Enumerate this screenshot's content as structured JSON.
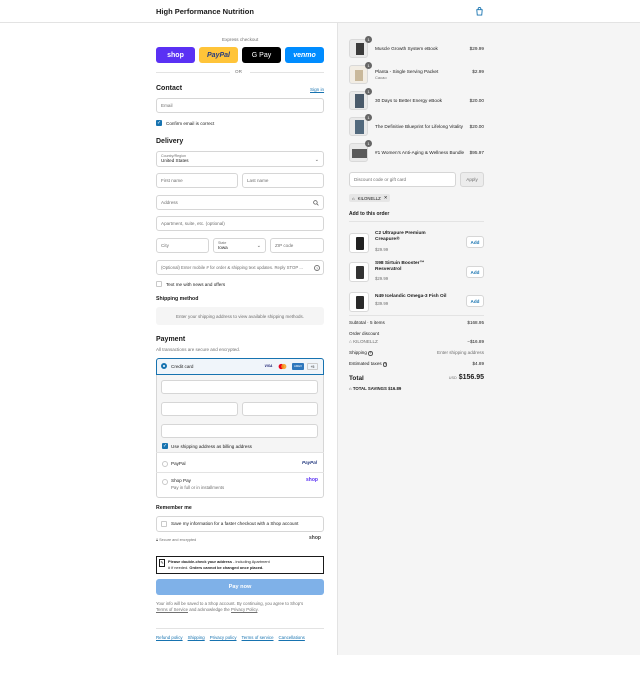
{
  "header": {
    "brand": "High Performance Nutrition"
  },
  "express": {
    "label": "Express checkout",
    "buttons": [
      "shop",
      "PayPal",
      "G Pay",
      "venmo"
    ],
    "or": "OR"
  },
  "contact": {
    "title": "Contact",
    "sign_in": "Sign in",
    "email_placeholder": "Email",
    "confirm_label": "Confirm email is correct"
  },
  "delivery": {
    "title": "Delivery",
    "country_label": "Country/Region",
    "country_value": "United States",
    "first_name": "First name",
    "last_name": "Last name",
    "address": "Address",
    "apartment": "Apartment, suite, etc. (optional)",
    "city": "City",
    "state_label": "State",
    "state_value": "Iowa",
    "zip": "ZIP code",
    "mobile": "(Optional) Enter mobile # for order & shipping text updates. Reply STOP ...",
    "text_me": "Text me with news and offers"
  },
  "shipping_method": {
    "title": "Shipping method",
    "note": "Enter your shipping address to view available shipping methods."
  },
  "payment": {
    "title": "Payment",
    "subtitle": "All transactions are secure and encrypted.",
    "credit_card": "Credit card",
    "card_brands": [
      "VISA",
      "MC",
      "AMEX",
      "+5"
    ],
    "use_shipping": "Use shipping address as billing address",
    "paypal": "PayPal",
    "paypal_logo": "PayPal",
    "shoppay": "Shop Pay",
    "shoppay_sub": "Pay in full or in installments",
    "shoppay_logo": "shop"
  },
  "remember": {
    "title": "Remember me",
    "save_label": "Save my information for a faster checkout with a Shop account",
    "secure": "Secure and encrypted",
    "shop_logo": "shop"
  },
  "notice": {
    "bold1": "Please double-check your address",
    "rest1": " - including Apartment",
    "rest2": "# if needed. ",
    "bold2": "Orders cannot be changed once placed."
  },
  "pay_now": "Pay now",
  "terms": {
    "line1": "Your info will be saved to a Shop account. By continuing, you agree to Shop’s",
    "tos": "Terms of Service",
    "and": " and acknowledge the ",
    "privacy": "Privacy Policy",
    "end": "."
  },
  "footer_links": [
    "Refund policy",
    "Shipping",
    "Privacy policy",
    "Terms of service",
    "Cancellations"
  ],
  "cart": {
    "items": [
      {
        "name": "Muscle Growth System eBook",
        "variant": "",
        "qty": "1",
        "price": "$29.99"
      },
      {
        "name": "Planta - Single Serving Packet",
        "variant": "Cacao",
        "qty": "1",
        "price": "$2.99"
      },
      {
        "name": "30 Days to Better Energy eBook",
        "variant": "",
        "qty": "1",
        "price": "$20.00"
      },
      {
        "name": "The Definitive Blueprint for Lifelong Vitality",
        "variant": "",
        "qty": "1",
        "price": "$20.00"
      },
      {
        "name": "#1 Women’s Anti-Aging & Wellness Bundle",
        "variant": "",
        "qty": "1",
        "price": "$95.97"
      }
    ],
    "discount_placeholder": "Discount code or gift card",
    "apply": "Apply",
    "code": "KILONELLZ",
    "add_title": "Add to this order",
    "upsells": [
      {
        "name1": "C2 Ultrapure Premium",
        "name2": "Creapure®",
        "price": "$29.99",
        "button": "Add"
      },
      {
        "name1": "S98 Sirtuin Booster™",
        "name2": "Resveratrol",
        "price": "$29.99",
        "button": "Add"
      },
      {
        "name1": "N49 Icelandic Omega-3 Fish Oil",
        "name2": "",
        "price": "$39.99",
        "button": "Add"
      }
    ]
  },
  "summary": {
    "subtotal_label": "Subtotal · 5 items",
    "subtotal": "$168.95",
    "order_discount": "Order discount",
    "discount_code": "KILONELLZ",
    "discount_value": "−$16.89",
    "shipping_label": "Shipping",
    "shipping_value": "Enter shipping address",
    "taxes_label": "Estimated taxes",
    "taxes_value": "$4.89",
    "total_label": "Total",
    "currency": "USD",
    "total": "$156.95",
    "savings_label": "TOTAL SAVINGS",
    "savings_value": "$16.89"
  },
  "colors": {
    "accent": "#1773b0",
    "pay_now": "#7fb1e8",
    "shop": "#5a31f4",
    "paypal": "#ffc439",
    "venmo": "#008cff"
  }
}
